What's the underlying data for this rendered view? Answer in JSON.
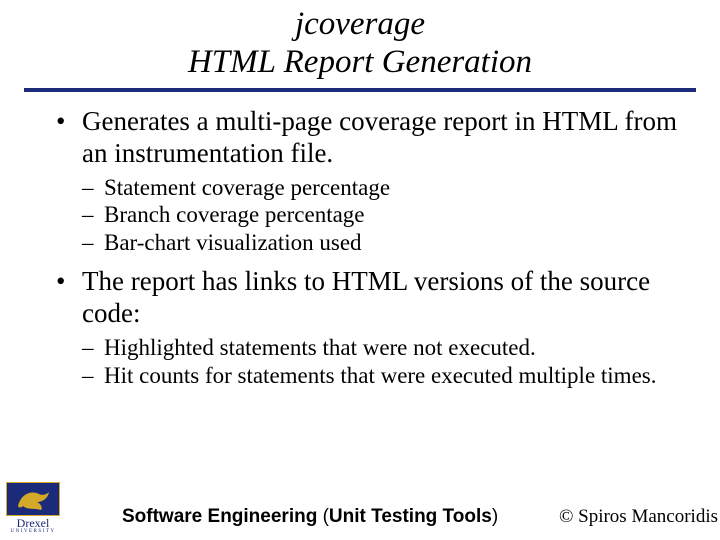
{
  "title": {
    "line1": "jcoverage",
    "line2": "HTML Report Generation"
  },
  "bullets": [
    {
      "text": "Generates a multi-page coverage report in HTML from an instrumentation file.",
      "sub": [
        "Statement coverage percentage",
        "Branch coverage percentage",
        "Bar-chart visualization used"
      ]
    },
    {
      "text": "The report has links to HTML versions of the source code:",
      "sub": [
        "Highlighted statements that were not executed.",
        "Hit counts for statements that were executed multiple times."
      ]
    }
  ],
  "logo": {
    "name": "Drexel",
    "sub": "UNIVERSITY"
  },
  "footer": {
    "center_bold1": "Software Engineering ",
    "center_plain": "(",
    "center_bold2": "Unit Testing Tools",
    "center_plain2": ")",
    "right": "© Spiros Mancoridis"
  },
  "colors": {
    "rule": "#1b2b7a",
    "logo_gold": "#d4a92a"
  }
}
